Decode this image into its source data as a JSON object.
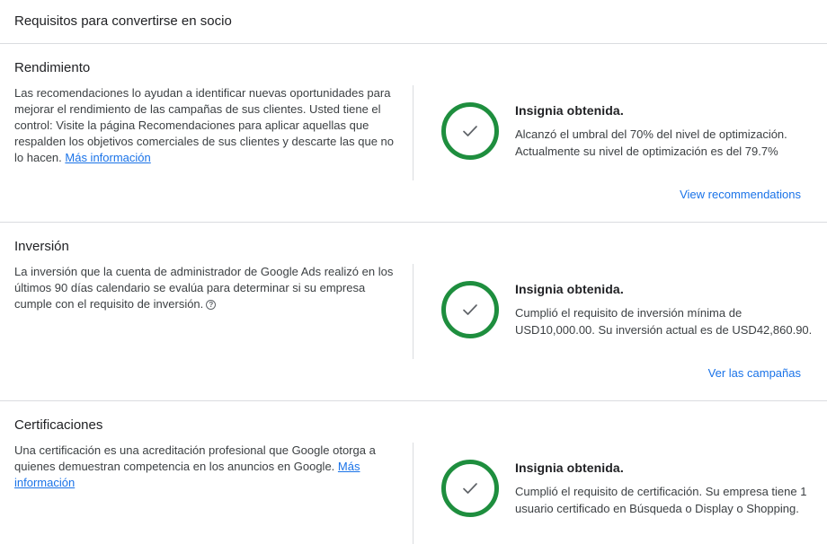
{
  "page": {
    "title": "Requisitos para convertirse en socio"
  },
  "sections": [
    {
      "title": "Rendimiento",
      "description": "Las recomendaciones lo ayudan a identificar nuevas oportunidades para mejorar el rendimiento de las campañas de sus clientes. Usted tiene el control: Visite la página Recomendaciones para aplicar aquellas que respalden los objetivos comerciales de sus clientes y descarte las que no lo hacen.",
      "learn_more": "Más información",
      "badge_icon": "check-icon",
      "badge_title": "Insignia obtenida.",
      "badge_desc": "Alcanzó el umbral del 70% del nivel de optimización. Actualmente su nivel de optimización es del 79.7%",
      "action": "View recommendations"
    },
    {
      "title": "Inversión",
      "description": "La inversión que la cuenta de administrador de Google Ads realizó en los últimos 90 días calendario se evalúa para determinar si su empresa cumple con el requisito de inversión.",
      "help_icon": "help-icon",
      "help_glyph": "?",
      "badge_icon": "check-icon",
      "badge_title": "Insignia obtenida.",
      "badge_desc": "Cumplió el requisito de inversión mínima de USD10,000.00. Su inversión actual es de USD42,860.90.",
      "action": "Ver las campañas"
    },
    {
      "title": "Certificaciones",
      "description": "Una certificación es una acreditación profesional que Google otorga a quienes demuestran competencia en los anuncios en Google.",
      "learn_more": "Más información",
      "badge_icon": "check-icon",
      "badge_title": "Insignia obtenida.",
      "badge_desc": "Cumplió el requisito de certificación. Su empresa tiene 1 usuario certificado en Búsqueda o Display o Shopping."
    }
  ],
  "colors": {
    "badge_green": "#1e8e3e",
    "link_blue": "#1a73e8",
    "check_gray": "#5f6368"
  }
}
